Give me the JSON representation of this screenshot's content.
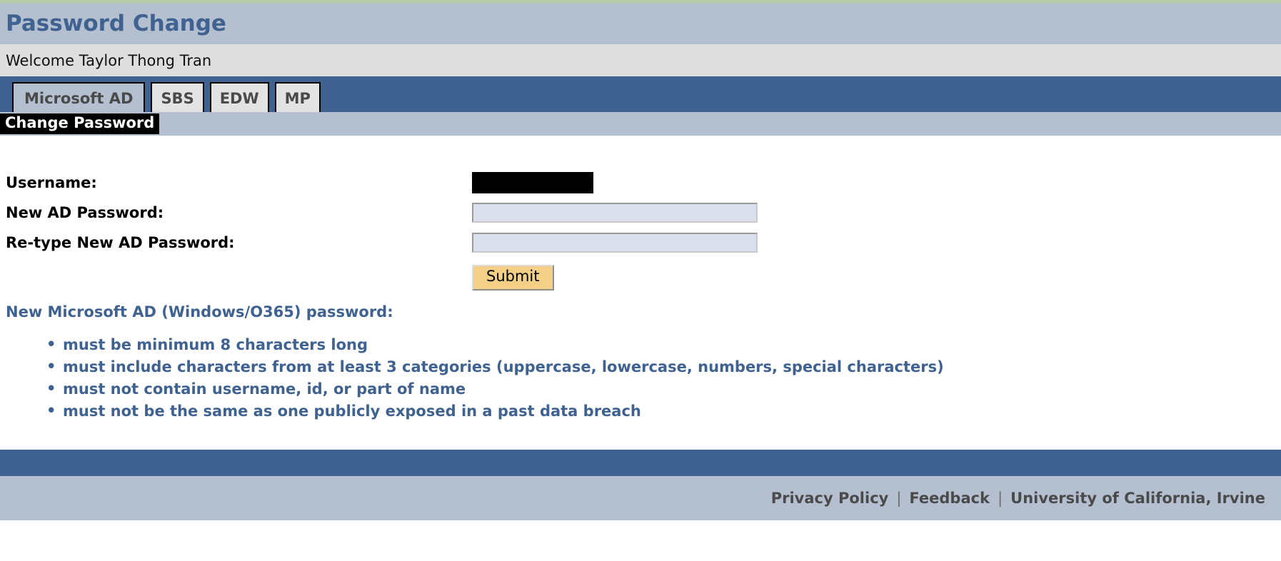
{
  "page": {
    "title": "Password Change",
    "welcome": "Welcome Taylor Thong Tran",
    "section_title": "Change Password"
  },
  "colors": {
    "top_rule": "#b4ccaa",
    "band_blue_gray": "#b4c0cf",
    "welcome_gray": "#dedede",
    "tab_bar_blue": "#3f6291",
    "tab_inactive": "#e3e3e3",
    "accent_blue": "#3f6291",
    "input_fill": "#d9dfec",
    "submit_fill": "#f4cf86",
    "redaction": "#000000"
  },
  "tabs": [
    {
      "label": "Microsoft AD",
      "active": true
    },
    {
      "label": "SBS",
      "active": false
    },
    {
      "label": "EDW",
      "active": false
    },
    {
      "label": "MP",
      "active": false
    }
  ],
  "form": {
    "username_label": "Username:",
    "username_value": "",
    "username_redacted": true,
    "new_password_label": "New AD Password:",
    "new_password_value": "",
    "new_password_placeholder": "",
    "retype_password_label": "Re-type New AD Password:",
    "retype_password_value": "",
    "retype_password_placeholder": "",
    "submit_label": "Submit"
  },
  "requirements": {
    "heading": "New Microsoft AD (Windows/O365) password:",
    "items": [
      "must be minimum 8 characters long",
      "must include characters from at least 3 categories (uppercase, lowercase, numbers, special characters)",
      "must not contain username, id, or part of name",
      "must not be the same as one publicly exposed in a past data breach"
    ]
  },
  "footer": {
    "privacy_policy": "Privacy Policy",
    "separator": "|",
    "feedback": "Feedback",
    "institution": "University of California, Irvine"
  }
}
